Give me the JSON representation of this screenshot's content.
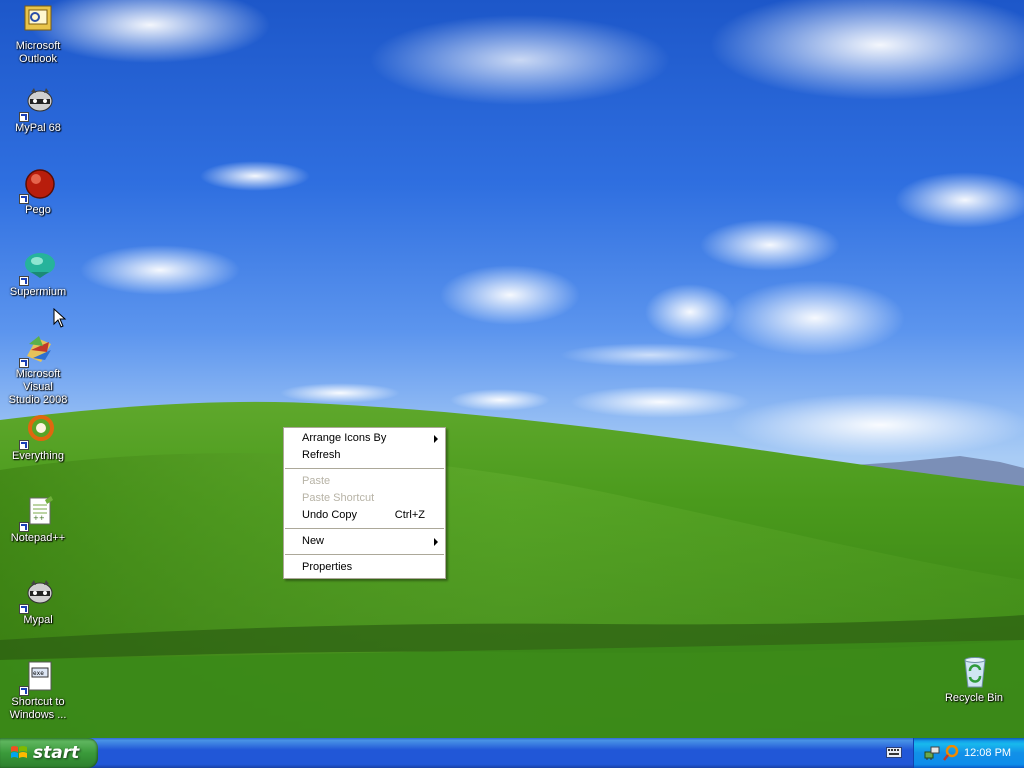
{
  "desktop": {
    "icons": [
      {
        "id": "outlook",
        "label": "Microsoft\nOutlook",
        "icon": "outlook-icon",
        "shortcut": false
      },
      {
        "id": "mypal68",
        "label": "MyPal 68",
        "icon": "mypal-raccoon-icon",
        "shortcut": true
      },
      {
        "id": "pego",
        "label": "Pego",
        "icon": "pego-red-ball-icon",
        "shortcut": true
      },
      {
        "id": "supermium",
        "label": "Supermium",
        "icon": "supermium-icon",
        "shortcut": true
      },
      {
        "id": "msvs2008",
        "label": "Microsoft Visual\nStudio 2008",
        "icon": "visual-studio-icon",
        "shortcut": true
      },
      {
        "id": "everything",
        "label": "Everything",
        "icon": "everything-search-icon",
        "shortcut": true
      },
      {
        "id": "notepadpp",
        "label": "Notepad++",
        "icon": "notepad-plus-plus-icon",
        "shortcut": true
      },
      {
        "id": "mypal",
        "label": "Mypal",
        "icon": "mypal-raccoon-icon",
        "shortcut": true
      },
      {
        "id": "shortcut-windows",
        "label": "Shortcut to\nWindows ...",
        "icon": "windows-folder-icon",
        "shortcut": true
      }
    ],
    "recycle_bin": {
      "label": "Recycle Bin",
      "icon": "recycle-bin-icon"
    }
  },
  "context_menu": {
    "items": [
      {
        "label": "Arrange Icons By",
        "submenu": true,
        "disabled": false
      },
      {
        "label": "Refresh",
        "disabled": false
      },
      {
        "separator": true
      },
      {
        "label": "Paste",
        "disabled": true
      },
      {
        "label": "Paste Shortcut",
        "disabled": true
      },
      {
        "label": "Undo Copy",
        "shortcut": "Ctrl+Z",
        "disabled": false
      },
      {
        "separator": true
      },
      {
        "label": "New",
        "submenu": true,
        "disabled": false
      },
      {
        "separator": true
      },
      {
        "label": "Properties",
        "disabled": false
      }
    ]
  },
  "taskbar": {
    "start_label": "start",
    "clock": "12:08 PM",
    "tray_icons": [
      "network-icon",
      "search-tray-icon"
    ],
    "keyboard_indicator": "keyboard-icon"
  },
  "colors": {
    "taskbar_blue": "#2157d7",
    "start_green": "#3a9a3a",
    "tray_blue": "#1290e8",
    "menu_border": "#aca899"
  }
}
